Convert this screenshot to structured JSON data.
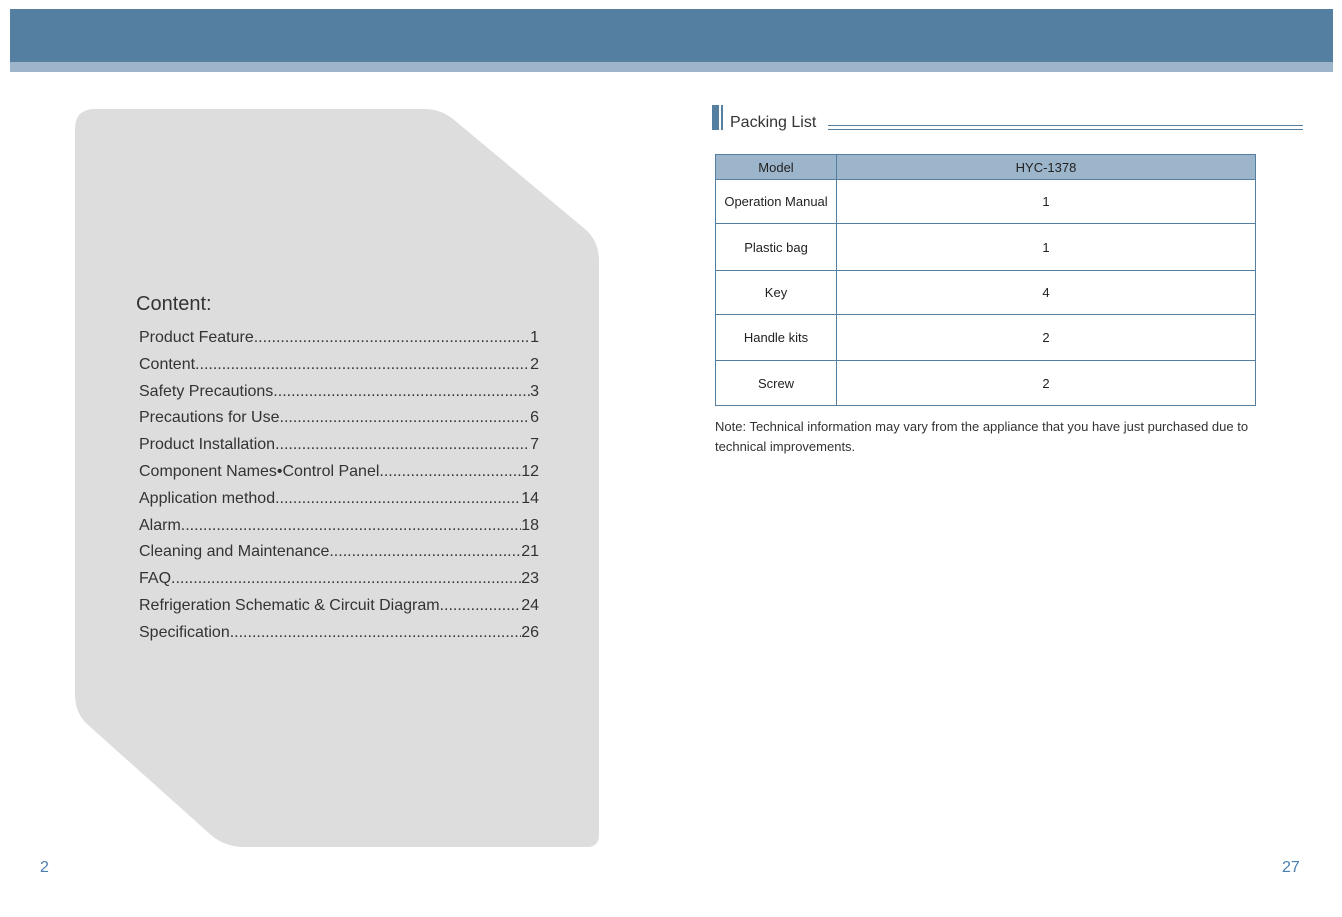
{
  "contents": {
    "title": "Content:",
    "items": [
      {
        "label": "Product Feature",
        "page": "1"
      },
      {
        "label": "Content",
        "page": "2"
      },
      {
        "label": "Safety Precautions",
        "page": "3"
      },
      {
        "label": "Precautions for Use",
        "page": "6"
      },
      {
        "label": "Product Installation ",
        "page": "7"
      },
      {
        "label": "Component Names•Control Panel",
        "page": "12"
      },
      {
        "label": "Application method ",
        "page": "14"
      },
      {
        "label": "Alarm",
        "page": "18"
      },
      {
        "label": "Cleaning and Maintenance",
        "page": "21"
      },
      {
        "label": "FAQ",
        "page": "23"
      },
      {
        "label": "Refrigeration Schematic & Circuit Diagram",
        "page": "24"
      },
      {
        "label": "Specification",
        "page": "26"
      }
    ]
  },
  "packing_list": {
    "title": "Packing List",
    "header": {
      "col1": "Model",
      "col2": "HYC-1378"
    },
    "rows": [
      {
        "item": "Operation Manual",
        "qty": "1"
      },
      {
        "item": "Plastic bag",
        "qty": "1"
      },
      {
        "item": "Key",
        "qty": "4"
      },
      {
        "item": "Handle kits",
        "qty": "2"
      },
      {
        "item": "Screw",
        "qty": "2"
      }
    ],
    "note": "Note: Technical information may vary from the appliance that you have just purchased due to technical improvements."
  },
  "page_numbers": {
    "left": "2",
    "right": "27"
  },
  "colors": {
    "accent": "#547fa0",
    "accent_light": "#9cb5ca",
    "panel": "#dddddd"
  }
}
